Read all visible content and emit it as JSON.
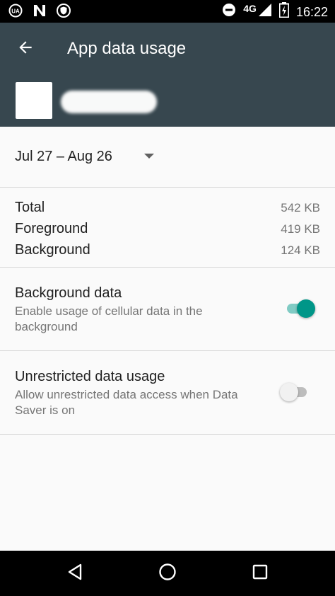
{
  "status_bar": {
    "network": "4G",
    "time": "16:22",
    "icons": [
      "ua-icon",
      "n-icon",
      "shield-icon",
      "dnd-icon",
      "signal-icon",
      "battery-charging-icon"
    ]
  },
  "app_bar": {
    "title": "App data usage",
    "back_icon": "arrow-back-icon"
  },
  "cycle": {
    "label": "Jul 27 – Aug 26"
  },
  "usage": {
    "total_label": "Total",
    "total_value": "542 KB",
    "foreground_label": "Foreground",
    "foreground_value": "419 KB",
    "background_label": "Background",
    "background_value": "124 KB"
  },
  "settings": {
    "background_data": {
      "title": "Background data",
      "summary": "Enable usage of cellular data in the background",
      "enabled": true
    },
    "unrestricted": {
      "title": "Unrestricted data usage",
      "summary": "Allow unrestricted data access when Data Saver is on",
      "enabled": false
    }
  },
  "colors": {
    "app_bar": "#37474f",
    "accent": "#009688",
    "accent_track": "#80cbc4"
  },
  "nav_bar": {
    "icons": [
      "back-triangle-icon",
      "home-circle-icon",
      "recents-square-icon"
    ]
  }
}
